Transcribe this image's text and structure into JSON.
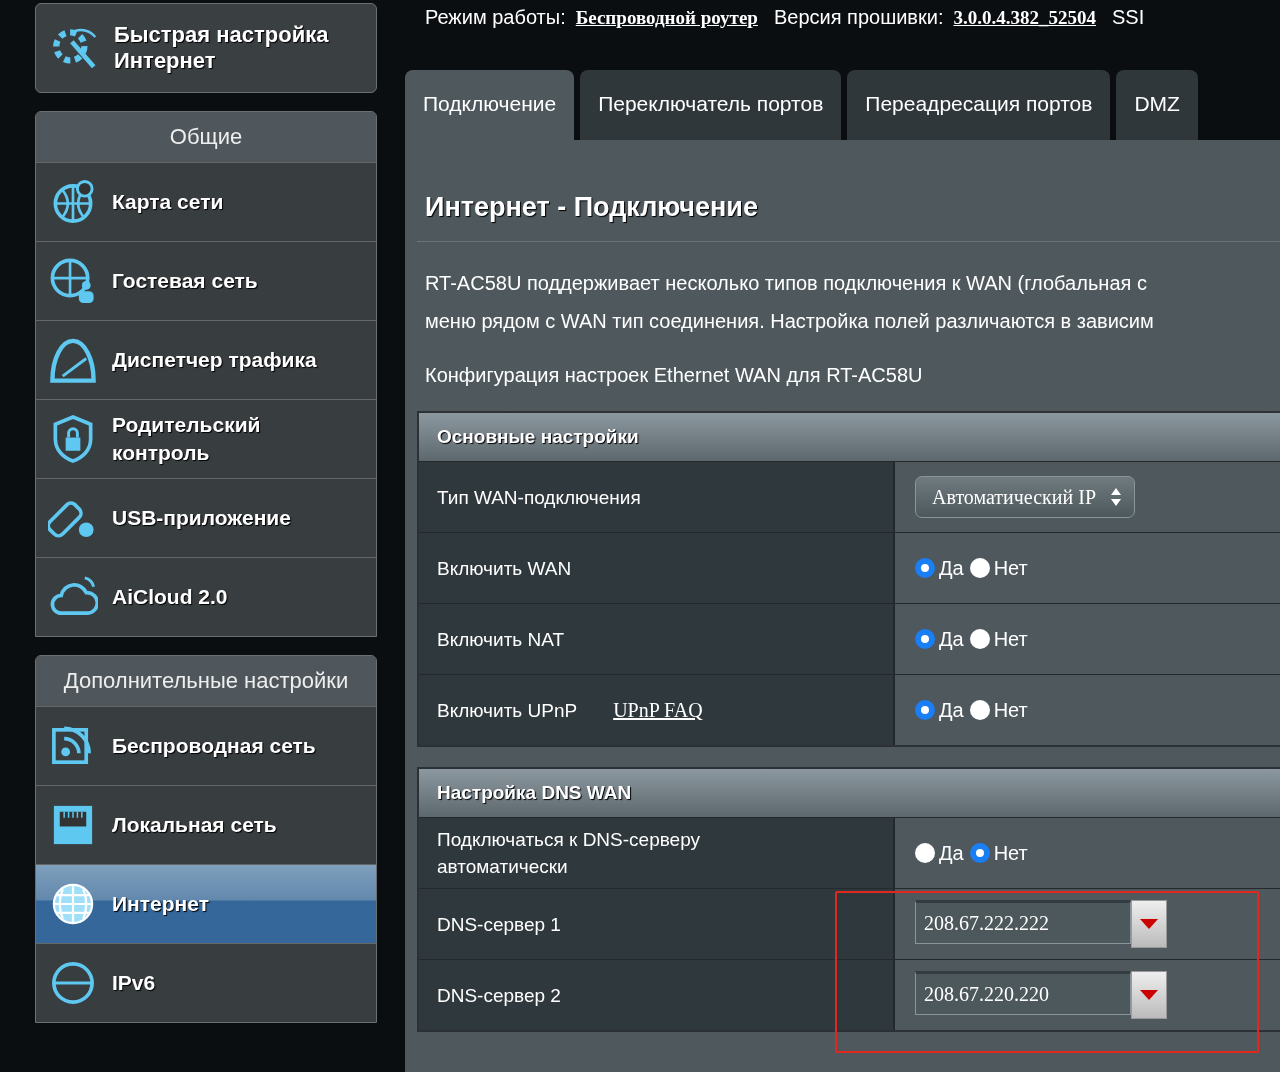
{
  "sidebar": {
    "quick_setup": {
      "label": "Быстрая настройка Интернет"
    },
    "groups": [
      {
        "title": "Общие",
        "items": [
          {
            "label": "Карта сети",
            "selected": false
          },
          {
            "label": "Гостевая сеть",
            "selected": false
          },
          {
            "label": "Диспетчер трафика",
            "selected": false
          },
          {
            "label": "Родительский контроль",
            "selected": false
          },
          {
            "label": "USB-приложение",
            "selected": false
          },
          {
            "label": "AiCloud 2.0",
            "selected": false
          }
        ]
      },
      {
        "title": "Дополнительные настройки",
        "items": [
          {
            "label": "Беспроводная сеть",
            "selected": false
          },
          {
            "label": "Локальная сеть",
            "selected": false
          },
          {
            "label": "Интернет",
            "selected": true
          },
          {
            "label": "IPv6",
            "selected": false
          }
        ]
      }
    ]
  },
  "status": [
    {
      "label": "Режим работы:",
      "value": "Беспроводной роутер"
    },
    {
      "label": "Версия прошивки:",
      "value": "3.0.0.4.382_52504"
    },
    {
      "label": "SSI"
    }
  ],
  "tabs": [
    {
      "label": "Подключение",
      "selected": true
    },
    {
      "label": "Переключатель портов",
      "selected": false
    },
    {
      "label": "Переадресация портов",
      "selected": false
    },
    {
      "label": "DMZ",
      "selected": false
    }
  ],
  "page": {
    "title": "Интернет - Подключение",
    "description": [
      "RT-AC58U поддерживает несколько типов подключения к WAN (глобальная с",
      "меню рядом с WAN тип соединения. Настройка полей различаются в зависим"
    ],
    "subtitle": "Конфигурация настроек Ethernet WAN для RT-AC58U"
  },
  "sections": [
    {
      "title": "Основные настройки",
      "rows": [
        {
          "kind": "select",
          "label": "Тип WAN-подключения",
          "value": "Автоматический IP"
        },
        {
          "kind": "radio",
          "label": "Включить WAN",
          "options": [
            {
              "label": "Да",
              "selected": true
            },
            {
              "label": "Нет",
              "selected": false
            }
          ]
        },
        {
          "kind": "radio",
          "label": "Включить NAT",
          "options": [
            {
              "label": "Да",
              "selected": true
            },
            {
              "label": "Нет",
              "selected": false
            }
          ]
        },
        {
          "kind": "radio",
          "label": "Включить UPnP",
          "link": "UPnP FAQ",
          "options": [
            {
              "label": "Да",
              "selected": true
            },
            {
              "label": "Нет",
              "selected": false
            }
          ]
        }
      ]
    },
    {
      "title": "Настройка DNS WAN",
      "rows": [
        {
          "kind": "radio",
          "label": "Подключаться к DNS-серверу автоматически",
          "options": [
            {
              "label": "Да",
              "selected": false
            },
            {
              "label": "Нет",
              "selected": true
            }
          ]
        },
        {
          "kind": "ip",
          "label": "DNS-сервер 1",
          "value": "208.67.222.222"
        },
        {
          "kind": "ip",
          "label": "DNS-сервер 2",
          "value": "208.67.220.220"
        }
      ]
    }
  ]
}
